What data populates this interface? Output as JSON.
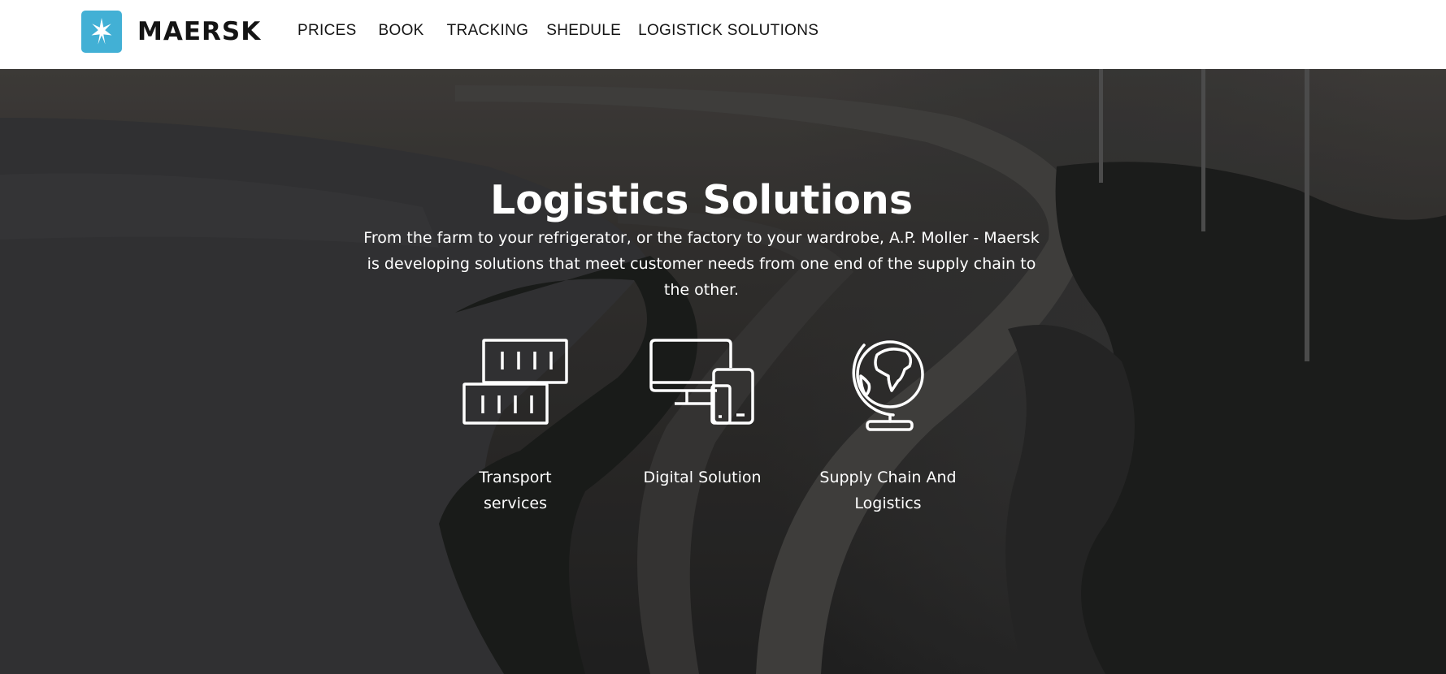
{
  "brand": {
    "name": "MAERSK",
    "logo_icon": "seven-point-star-icon",
    "logo_color": "#42b0d5"
  },
  "nav": {
    "items": [
      {
        "label": "PRICES"
      },
      {
        "label": "BOOK"
      },
      {
        "label": "TRACKING"
      },
      {
        "label": "SHEDULE"
      },
      {
        "label": "LOGISTICK SOLUTIONS"
      }
    ]
  },
  "hero": {
    "title": "Logistics Solutions",
    "description": "From the farm to your refrigerator, or the factory to your wardrobe, A.P. Moller - Maersk is developing solutions that meet customer needs from one end of the supply chain to the other.",
    "cards": [
      {
        "label": "Transport services",
        "icon": "shipping-containers-icon"
      },
      {
        "label": "Digital Solution",
        "icon": "devices-icon"
      },
      {
        "label": "Supply Chain And Logistics",
        "icon": "globe-icon"
      }
    ]
  }
}
